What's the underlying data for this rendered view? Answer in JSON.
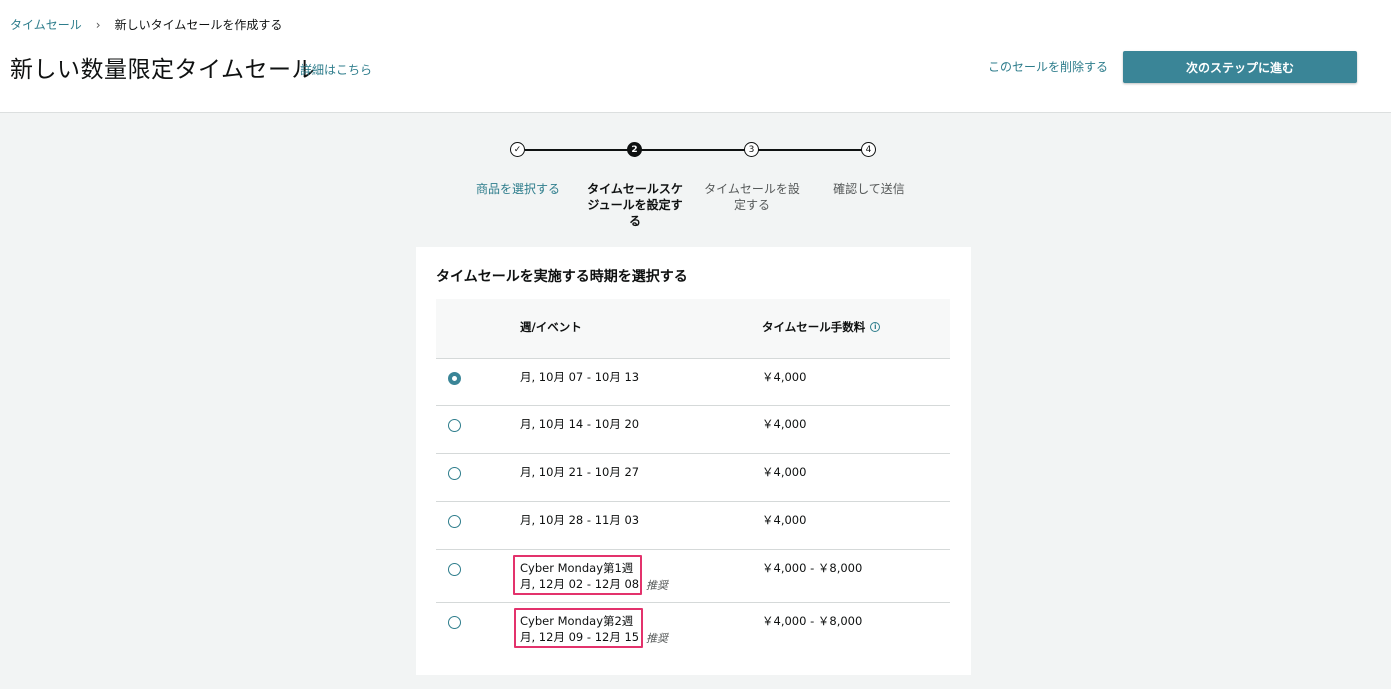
{
  "breadcrumb": {
    "parent": "タイムセール",
    "separator": "›",
    "current": "新しいタイムセールを作成する"
  },
  "header": {
    "title": "新しい数量限定タイムセール",
    "details_link": "詳細はこちら",
    "delete_link": "このセールを削除する",
    "next_button": "次のステップに進む"
  },
  "stepper": {
    "steps": [
      {
        "label": "商品を選択する",
        "marker": "✓",
        "state": "done"
      },
      {
        "label": "タイムセールスケジュールを設定する",
        "marker": "2",
        "state": "active"
      },
      {
        "label": "タイムセールを設定する",
        "marker": "3",
        "state": "upcoming"
      },
      {
        "label": "確認して送信",
        "marker": "4",
        "state": "upcoming"
      }
    ]
  },
  "schedule": {
    "title": "タイムセールを実施する時期を選択する",
    "col_week": "週/イベント",
    "col_fee": "タイムセール手数料",
    "info_icon": "i",
    "recommend_label": "推奨",
    "rows": [
      {
        "selected": true,
        "event": "",
        "dates": "月, 10月 07 - 10月 13",
        "fee": "￥4,000",
        "recommended": false
      },
      {
        "selected": false,
        "event": "",
        "dates": "月, 10月 14 - 10月 20",
        "fee": "￥4,000",
        "recommended": false
      },
      {
        "selected": false,
        "event": "",
        "dates": "月, 10月 21 - 10月 27",
        "fee": "￥4,000",
        "recommended": false
      },
      {
        "selected": false,
        "event": "",
        "dates": "月, 10月 28 - 11月 03",
        "fee": "￥4,000",
        "recommended": false
      },
      {
        "selected": false,
        "event": "Cyber Monday第1週",
        "dates": "月, 12月 02 - 12月 08",
        "fee": "￥4,000 - ￥8,000",
        "recommended": true
      },
      {
        "selected": false,
        "event": "Cyber Monday第2週",
        "dates": "月, 12月 09 - 12月 15",
        "fee": "￥4,000 - ￥8,000",
        "recommended": true
      }
    ]
  },
  "colors": {
    "accent": "#3a8597",
    "link": "#2e7d8c",
    "highlight": "#e3326c"
  }
}
